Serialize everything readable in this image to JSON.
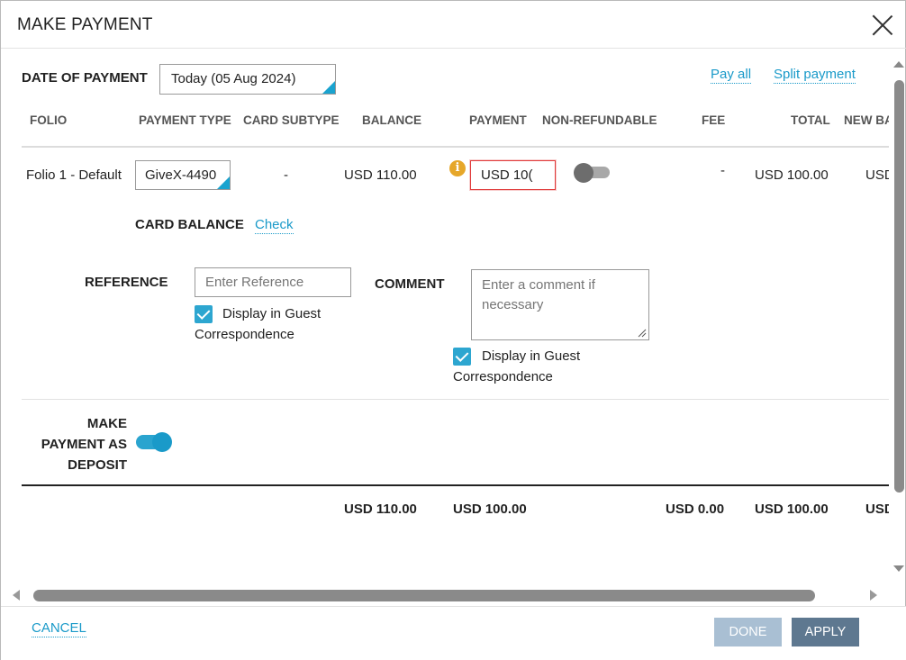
{
  "dialog": {
    "title": "MAKE PAYMENT"
  },
  "header": {
    "date_label": "DATE OF PAYMENT",
    "date_value": "Today (05 Aug 2024)",
    "pay_all": "Pay all",
    "split_payment": "Split payment"
  },
  "columns": [
    "FOLIO",
    "PAYMENT TYPE",
    "CARD SUBTYPE",
    "BALANCE",
    "PAYMENT",
    "NON-REFUNDABLE",
    "FEE",
    "TOTAL",
    "NEW BA"
  ],
  "row": {
    "folio": "Folio 1 - Default",
    "payment_type": "GiveX-4490",
    "card_subtype": "-",
    "balance": "USD 110.00",
    "payment": "USD 10(",
    "non_refundable": false,
    "fee": "-",
    "total": "USD 100.00",
    "new_balance": "USD"
  },
  "card_balance": {
    "label": "CARD BALANCE",
    "check": "Check"
  },
  "reference": {
    "label": "REFERENCE",
    "placeholder": "Enter Reference",
    "display_line1": "Display in Guest",
    "display_line2": "Correspondence",
    "checked": true
  },
  "comment": {
    "label": "COMMENT",
    "placeholder": "Enter a comment if necessary",
    "display_line1": "Display in Guest",
    "display_line2": "Correspondence",
    "checked": true
  },
  "deposit": {
    "label_line1": "MAKE",
    "label_line2": "PAYMENT AS",
    "label_line3": "DEPOSIT",
    "enabled": true
  },
  "totals": {
    "balance": "USD 110.00",
    "payment": "USD 100.00",
    "fee": "USD 0.00",
    "total": "USD 100.00",
    "new_balance": "USD"
  },
  "footer": {
    "cancel": "CANCEL",
    "done": "DONE",
    "apply": "APPLY"
  },
  "colors": {
    "accent": "#1a9ac9",
    "error": "#e03a3a",
    "info": "#e6a72a",
    "done_bg": "#a9bfd3",
    "apply_bg": "#5e7890"
  },
  "icons": {
    "close": "close-icon",
    "info": "info-icon",
    "check": "checkmark-icon"
  }
}
